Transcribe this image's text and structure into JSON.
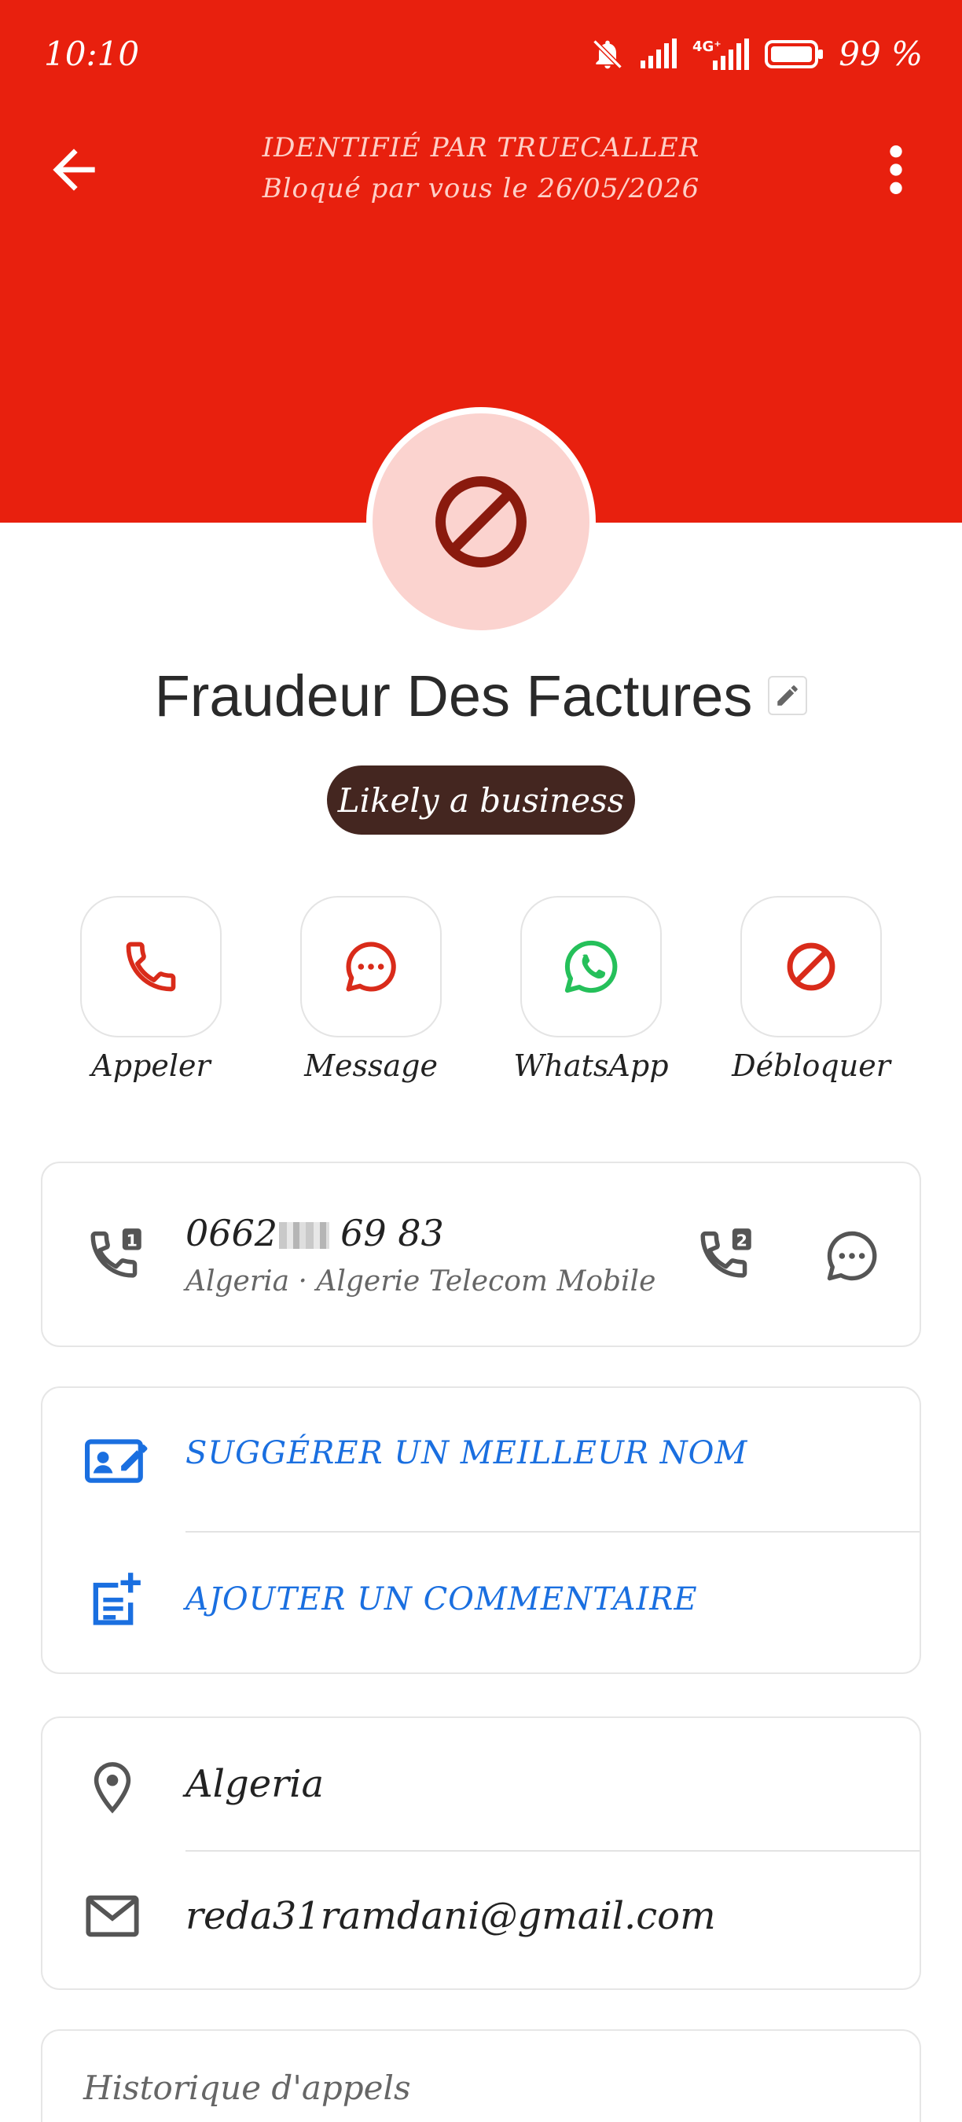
{
  "status_bar": {
    "time": "10:10",
    "network": "4G+",
    "battery": "99 %"
  },
  "header": {
    "line1": "IDENTIFIÉ PAR TRUECALLER",
    "line2": "Bloqué par vous le 26/05/2026",
    "bg_color": "#e8200e"
  },
  "contact": {
    "name": "Fraudeur Des Factures",
    "badge": "Likely a business"
  },
  "actions": [
    {
      "label": "Appeler",
      "icon": "phone-icon"
    },
    {
      "label": "Message",
      "icon": "message-icon"
    },
    {
      "label": "WhatsApp",
      "icon": "whatsapp-icon"
    },
    {
      "label": "Débloquer",
      "icon": "unblock-icon"
    }
  ],
  "phone": {
    "number_start": "0662",
    "number_end": "69 83",
    "details": "Algeria · Algerie Telecom Mobile"
  },
  "suggest": {
    "suggest_name": "SUGGÉRER UN MEILLEUR NOM",
    "add_comment": "AJOUTER UN COMMENTAIRE"
  },
  "info": {
    "location": "Algeria",
    "email": "reda31ramdani@gmail.com"
  },
  "history": {
    "title": "Historique d'appels"
  },
  "colors": {
    "accent_red": "#e8200e",
    "link_blue": "#1a6fe0",
    "whatsapp_green": "#25c05a",
    "badge_bg": "#442620"
  }
}
